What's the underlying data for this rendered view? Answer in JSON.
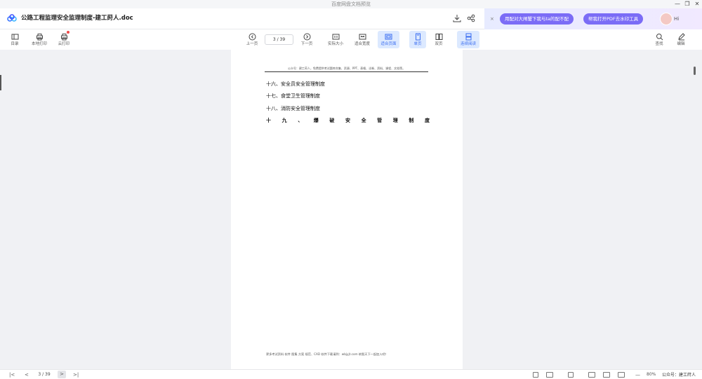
{
  "window": {
    "title": "百度网盘文档预览",
    "min": "—",
    "restore": "❐",
    "close": "✕"
  },
  "header": {
    "doc_title": "公路工程监理安全监理制度-建工莳人.doc"
  },
  "promo": {
    "close": "×",
    "pill1": "用配对大闸蟹下我与ta的配不配",
    "pill2": "帮我打开PDF去水印工具",
    "hi": "Hi"
  },
  "toolbar": {
    "left": [
      {
        "label": "目录",
        "icon": "toc-icon"
      },
      {
        "label": "本地打印",
        "icon": "printer-icon"
      },
      {
        "label": "云打印",
        "icon": "cloud-printer-icon"
      }
    ],
    "prev": "上一页",
    "page_indicator": "3 / 39",
    "next": "下一页",
    "view": [
      {
        "label": "实际大小",
        "icon": "actual-size-icon"
      },
      {
        "label": "适合宽度",
        "icon": "fit-width-icon"
      },
      {
        "label": "适合页面",
        "icon": "fit-page-icon",
        "active": true
      },
      {
        "label": "单页",
        "icon": "single-page-icon",
        "active": true
      },
      {
        "label": "双页",
        "icon": "double-page-icon"
      },
      {
        "label": "连续阅读",
        "icon": "continuous-icon",
        "active": true
      }
    ],
    "right": [
      {
        "label": "查找",
        "icon": "search-icon"
      },
      {
        "label": "编辑",
        "icon": "edit-icon"
      }
    ]
  },
  "document": {
    "header": "公众号：建工莳人，免费提供考试题库合集、资源、PPT、表格、试卷、资料、课程、文档等。",
    "lines": [
      "十六、安全员安全管理制度",
      "十七、食堂卫生管理制度",
      "十八、消防安全管理制度"
    ],
    "spread_line": [
      "十",
      "九",
      "、",
      "爆",
      "破",
      "安",
      "全",
      "管",
      "理",
      "制",
      "度"
    ],
    "footer": "更多考试资料 软件 图集 方案 规范、CAD 软件下载请到：wbjyjt.com 筑智天下一起加入吧！"
  },
  "statusbar": {
    "first": "|<",
    "prev": "<",
    "page": "3 / 39",
    "next": ">",
    "last": ">|",
    "zoom_minus": "—",
    "zoom": "80%",
    "watermark": "公众号：建工莳人"
  }
}
